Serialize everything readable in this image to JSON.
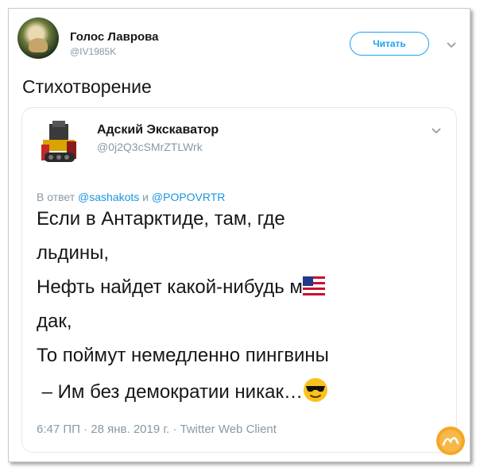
{
  "tweet": {
    "author_name": "Голос Лаврова",
    "author_handle": "@IV1985K",
    "follow_label": "Читать",
    "text": "Стихотворение"
  },
  "quoted": {
    "author_name": "Адский Экскаватор",
    "author_handle": "@0j2Q3cSMrZTLWrk",
    "reply_prefix": "В ответ",
    "reply_user1": "@sashakots",
    "reply_and": "и",
    "reply_user2": "@POPOVRTR",
    "lines": [
      "Если в Антарктиде, там, где",
      "льдины,",
      "Нефть найдет какой-нибудь м",
      "дак,",
      "То поймут немедленно пингвины",
      " – Им без демократии никак…"
    ],
    "meta": "6:47 ПП · 28 янв. 2019 г. · Twitter Web Client"
  },
  "icons": {
    "flag": "us-flag-icon",
    "emoji": "sunglasses-emoji-icon",
    "caret": "chevron-down-icon",
    "watermark": "site-logo-icon"
  },
  "colors": {
    "accent": "#1da1f2",
    "link": "#1b95e0",
    "muted": "#8899a6",
    "text": "#14171a"
  }
}
